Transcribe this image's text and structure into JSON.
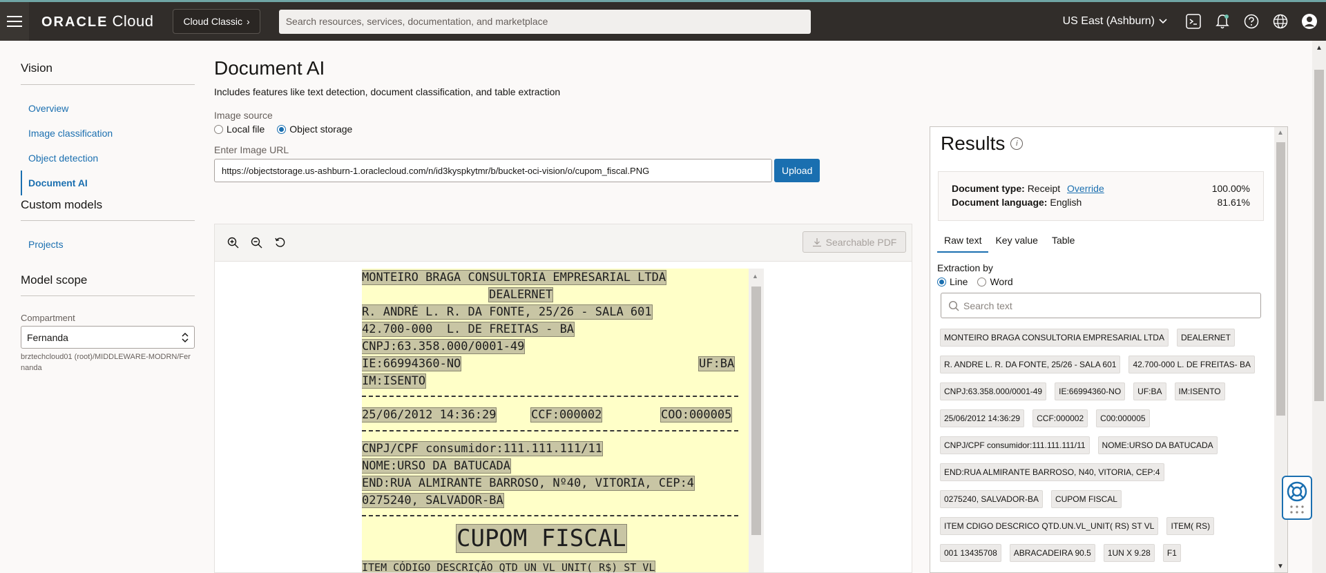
{
  "topbar": {
    "brand_oracle": "ORACLE",
    "brand_cloud": "Cloud",
    "classic_label": "Cloud Classic",
    "search_placeholder": "Search resources, services, documentation, and marketplace",
    "region": "US East (Ashburn)",
    "icons": [
      "cloud-shell-icon",
      "bell-icon",
      "help-icon",
      "globe-icon",
      "user-icon"
    ]
  },
  "leftnav": {
    "section1": "Vision",
    "items": [
      "Overview",
      "Image classification",
      "Object detection",
      "Document AI"
    ],
    "active_item": "Document AI",
    "section2": "Custom models",
    "items2": [
      "Projects"
    ],
    "section3": "Model scope",
    "compartment_label": "Compartment",
    "compartment_value": "Fernanda",
    "compartment_path": "brztechcloud01 (root)/MIDDLEWARE-MODRN/Fernanda"
  },
  "main": {
    "title": "Document AI",
    "subtitle": "Includes features like text detection, document classification, and table extraction",
    "image_source_label": "Image source",
    "source_local": "Local file",
    "source_object": "Object storage",
    "source_selected": "Object storage",
    "url_label": "Enter Image URL",
    "url_value": "https://objectstorage.us-ashburn-1.oraclecloud.com/n/id3kyspkytmr/b/bucket-oci-vision/o/cupom_fiscal.PNG",
    "upload_label": "Upload",
    "pdf_label": "Searchable PDF"
  },
  "receipt": {
    "lines": [
      "MONTEIRO BRAGA CONSULTORIA EMPRESARIAL LTDA",
      "DEALERNET",
      "R. ANDRÉ L. R. DA FONTE, 25/26 - SALA 601",
      "42.700-000  L. DE FREITAS - BA",
      "CNPJ:63.358.000/0001-49",
      "IE:66994360-NO",
      "UF:BA",
      "IM:ISENTO",
      "25/06/2012 14:36:29",
      "CCF:000002",
      "COO:000005",
      "CNPJ/CPF consumidor:111.111.111/11",
      "NOME:URSO DA BATUCADA",
      "END:RUA ALMIRANTE BARROSO, Nº40, VITORIA, CEP:4",
      "0275240, SALVADOR-BA",
      "CUPOM FISCAL",
      "ITEM CÓDIGO DESCRIÇÃO QTD UN VL UNIT( R$) ST VL"
    ]
  },
  "results": {
    "title": "Results",
    "doc_type_label": "Document type:",
    "doc_type_value": "Receipt",
    "override_label": "Override",
    "doc_type_conf": "100.00%",
    "doc_lang_label": "Document language:",
    "doc_lang_value": "English",
    "doc_lang_conf": "81.61%",
    "tabs": [
      "Raw text",
      "Key value",
      "Table"
    ],
    "active_tab": "Raw text",
    "extraction_label": "Extraction by",
    "extraction_line": "Line",
    "extraction_word": "Word",
    "search_placeholder": "Search text",
    "chips": [
      "MONTEIRO BRAGA CONSULTORIA EMPRESARIAL LTDA",
      "DEALERNET",
      "R. ANDRE L. R. DA FONTE, 25/26 - SALA 601",
      "42.700-000 L. DE FREITAS- BA",
      "CNPJ:63.358.000/0001-49",
      "IE:66994360-NO",
      "UF:BA",
      "IM:ISENTO",
      "25/06/2012 14:36:29",
      "CCF:000002",
      "C00:000005",
      "CNPJ/CPF consumidor:111.111.111/11",
      "NOME:URSO DA BATUCADA",
      "END:RUA ALMIRANTE BARROSO, N40, VITORIA, CEP:4",
      "0275240, SALVADOR-BA",
      "CUPOM FISCAL",
      "ITEM CDIGO DESCRICO QTD.UN.VL_UNIT( RS) ST VL",
      "ITEM( RS)",
      "001 13435708",
      "ABRACADEIRA 90.5",
      "1UN X 9.28",
      "F1"
    ]
  },
  "colors": {
    "accent": "#1a6fb0",
    "topbar": "#312d2a",
    "receipt_bg": "#ffffc8"
  }
}
